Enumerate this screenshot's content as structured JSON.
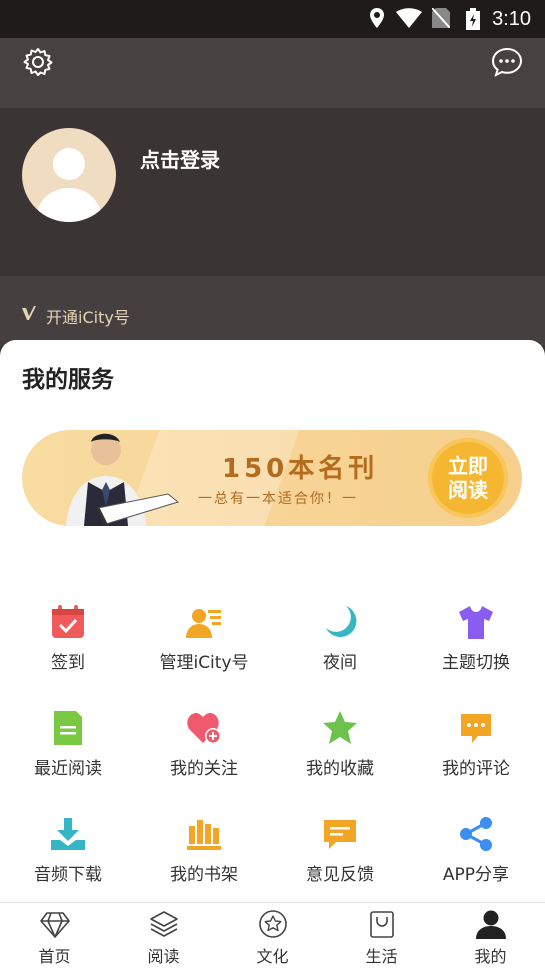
{
  "status": {
    "time": "3:10"
  },
  "header": {
    "login_label": "点击登录",
    "icity_label": "开通iCity号"
  },
  "services": {
    "title": "我的服务",
    "banner": {
      "headline": "150本名刊",
      "subline": "一总有一本适合你！一",
      "cta_line1": "立即",
      "cta_line2": "阅读"
    },
    "items": [
      {
        "label": "签到",
        "icon": "calendar-check-icon",
        "color": "#f05a5a"
      },
      {
        "label": "管理iCity号",
        "icon": "user-card-icon",
        "color": "#f2a623"
      },
      {
        "label": "夜间",
        "icon": "moon-icon",
        "color": "#35b6c4"
      },
      {
        "label": "主题切换",
        "icon": "tshirt-icon",
        "color": "#8a5cf0"
      },
      {
        "label": "最近阅读",
        "icon": "document-icon",
        "color": "#7ac943"
      },
      {
        "label": "我的关注",
        "icon": "heart-plus-icon",
        "color": "#f05a6e"
      },
      {
        "label": "我的收藏",
        "icon": "star-icon",
        "color": "#6cc24a"
      },
      {
        "label": "我的评论",
        "icon": "comment-icon",
        "color": "#f2a623"
      },
      {
        "label": "音频下载",
        "icon": "download-icon",
        "color": "#35b6c4"
      },
      {
        "label": "我的书架",
        "icon": "bookshelf-icon",
        "color": "#f2a623"
      },
      {
        "label": "意见反馈",
        "icon": "feedback-icon",
        "color": "#f2a623"
      },
      {
        "label": "APP分享",
        "icon": "share-icon",
        "color": "#3b8ff0"
      }
    ]
  },
  "tabs": [
    {
      "label": "首页",
      "icon": "diamond-icon"
    },
    {
      "label": "阅读",
      "icon": "layers-icon"
    },
    {
      "label": "文化",
      "icon": "star-circle-icon"
    },
    {
      "label": "生活",
      "icon": "bag-icon"
    },
    {
      "label": "我的",
      "icon": "user-icon"
    }
  ]
}
